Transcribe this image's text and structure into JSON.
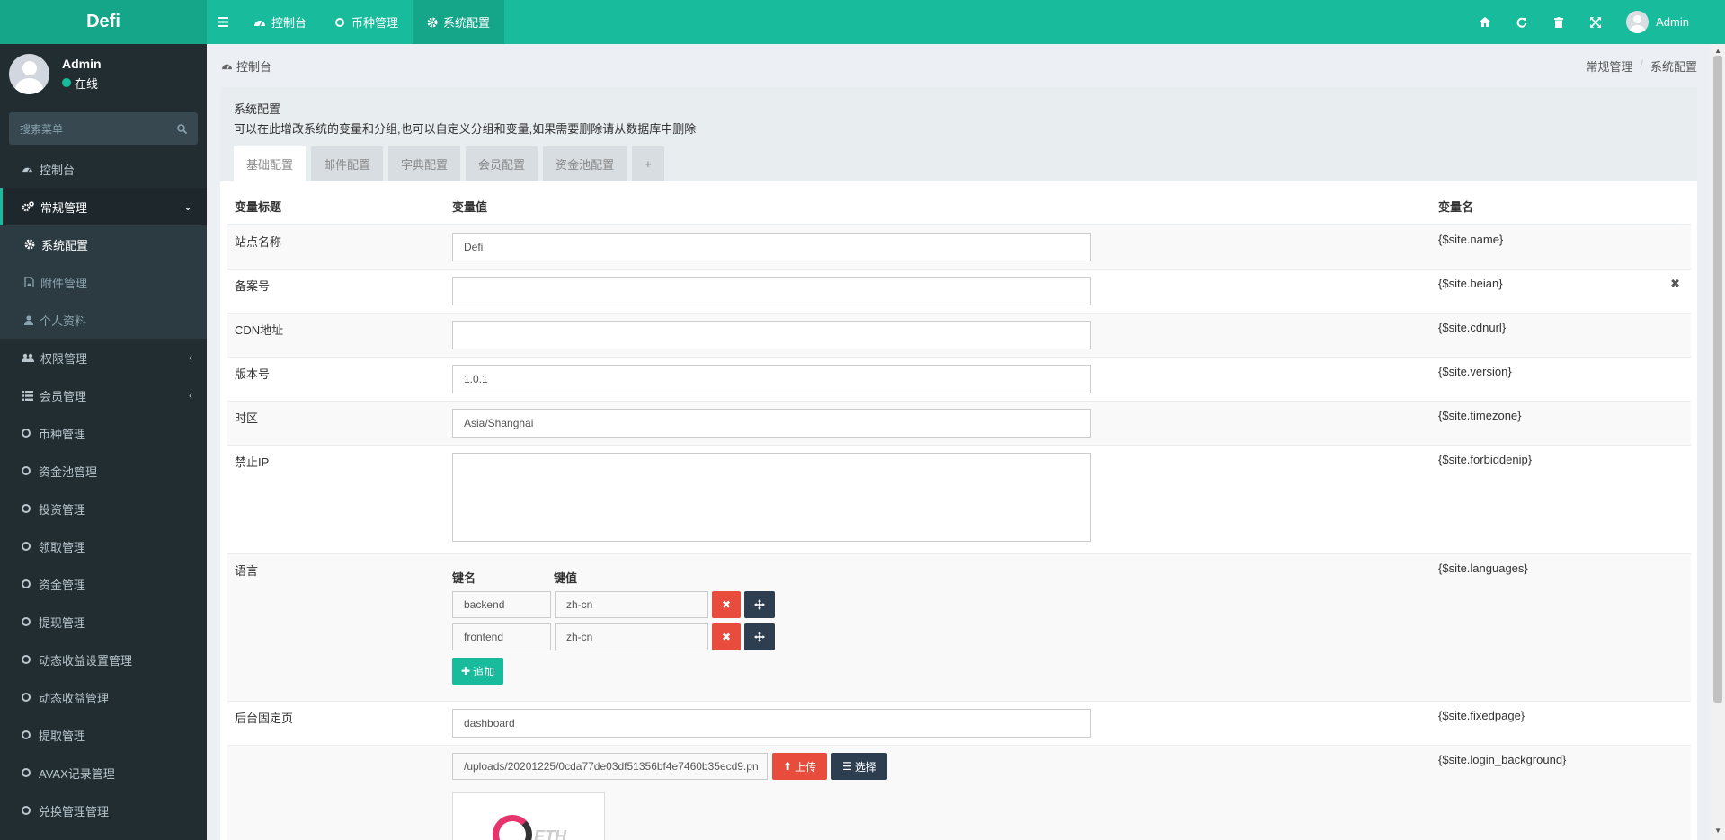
{
  "app": {
    "logo": "Defi"
  },
  "topnav": [
    {
      "icon": "dashboard-icon",
      "label": "控制台"
    },
    {
      "icon": "circle-icon",
      "label": "币种管理"
    },
    {
      "icon": "gear-icon",
      "label": "系统配置"
    }
  ],
  "topright": {
    "username": "Admin"
  },
  "user": {
    "name": "Admin",
    "status": "在线"
  },
  "search": {
    "placeholder": "搜索菜单"
  },
  "menu": {
    "dashboard": "控制台",
    "general": "常规管理",
    "sub": [
      "系统配置",
      "附件管理",
      "个人资料"
    ],
    "auth": "权限管理",
    "member": "会员管理",
    "items": [
      "币种管理",
      "资金池管理",
      "投资管理",
      "领取管理",
      "资金管理",
      "提现管理",
      "动态收益设置管理",
      "动态收益管理",
      "提取管理",
      "AVAX记录管理",
      "兑换管理管理"
    ]
  },
  "breadcrumb": {
    "left": "控制台",
    "right": [
      "常规管理",
      "系统配置"
    ]
  },
  "panel": {
    "title": "系统配置",
    "desc": "可以在此增改系统的变量和分组,也可以自定义分组和变量,如果需要删除请从数据库中删除",
    "tabs": [
      "基础配置",
      "邮件配置",
      "字典配置",
      "会员配置",
      "资金池配置",
      "+"
    ]
  },
  "table": {
    "headers": [
      "变量标题",
      "变量值",
      "变量名"
    ],
    "rows": [
      {
        "title": "站点名称",
        "value": "Defi",
        "name": "{$site.name}"
      },
      {
        "title": "备案号",
        "value": "",
        "name": "{$site.beian}"
      },
      {
        "title": "CDN地址",
        "value": "",
        "name": "{$site.cdnurl}"
      },
      {
        "title": "版本号",
        "value": "1.0.1",
        "name": "{$site.version}"
      },
      {
        "title": "时区",
        "value": "Asia/Shanghai",
        "name": "{$site.timezone}"
      },
      {
        "title": "禁止IP",
        "value": "",
        "name": "{$site.forbiddenip}"
      },
      {
        "title": "语言",
        "name": "{$site.languages}"
      },
      {
        "title": "后台固定页",
        "value": "dashboard",
        "name": "{$site.fixedpage}"
      },
      {
        "title": "",
        "value": "/uploads/20201225/0cda77de03df51356bf4e7460b35ecd9.pn",
        "name": "{$site.login_background}"
      }
    ],
    "lang": {
      "key_header": "键名",
      "val_header": "键值",
      "pairs": [
        {
          "key": "backend",
          "val": "zh-cn"
        },
        {
          "key": "frontend",
          "val": "zh-cn"
        }
      ],
      "add_label": "追加"
    },
    "upload_label": "上传",
    "select_label": "选择",
    "thumb_text": "ETH"
  },
  "colors": {
    "accent": "#18bc9c",
    "sidebar": "#222d32",
    "danger": "#e74c3c",
    "dark": "#2c3e50"
  }
}
